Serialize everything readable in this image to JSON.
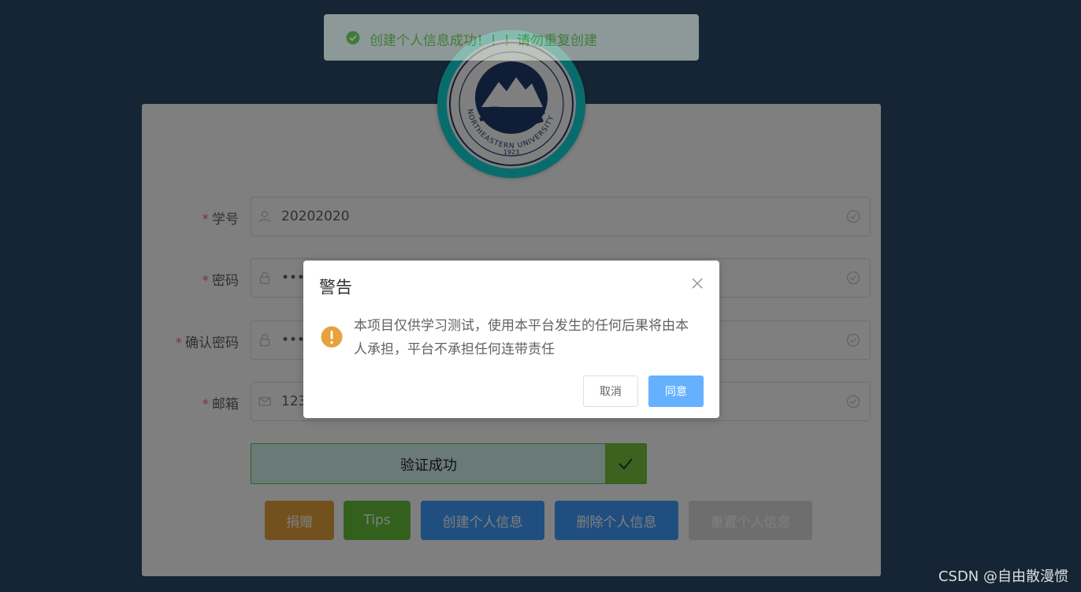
{
  "colors": {
    "page_bg": "#2b4b6b",
    "success": "#67c23a",
    "primary": "#409eff",
    "warning": "#e6a23c",
    "danger_required": "#f56c6c"
  },
  "logo": {
    "text_arc": "NORTHEASTERN UNIVERSITY",
    "year": "1923"
  },
  "toast": {
    "icon": "check-circle-icon",
    "message": "创建个人信息成功！！！请勿重复创建"
  },
  "form": {
    "required_mark": "*",
    "fields": [
      {
        "label": "学号",
        "icon": "user-icon",
        "value": "20202020"
      },
      {
        "label": "密码",
        "icon": "lock-icon",
        "value": "••••"
      },
      {
        "label": "确认密码",
        "icon": "lock-icon",
        "value": "••••"
      },
      {
        "label": "邮箱",
        "icon": "mail-icon",
        "value": "123"
      }
    ],
    "verify_text": "验证成功"
  },
  "buttons": {
    "donate": "捐赠",
    "tips": "Tips",
    "create": "创建个人信息",
    "delete": "删除个人信息",
    "reset": "重置个人信息"
  },
  "dialog": {
    "title": "警告",
    "message": "本项目仅供学习测试，使用本平台发生的任何后果将由本人承担，平台不承担任何连带责任",
    "cancel": "取消",
    "confirm": "同意"
  },
  "watermark": "CSDN @自由散漫惯"
}
